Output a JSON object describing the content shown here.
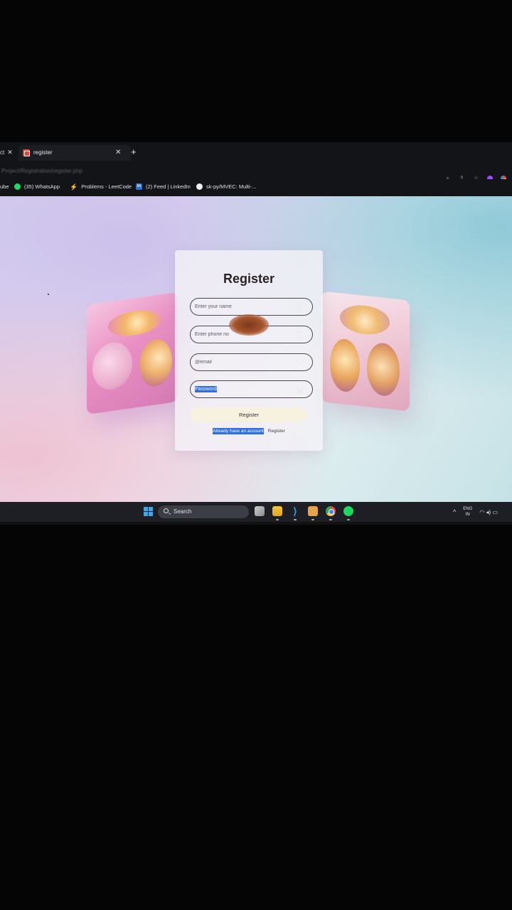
{
  "browser": {
    "prev_tab_label": "ct",
    "active_tab_title": "register",
    "url": "Project/Registration/register.php",
    "bookmarks": [
      {
        "label": "ube"
      },
      {
        "label": "(35) WhatsApp"
      },
      {
        "label": "Problems - LeetCode"
      },
      {
        "label": "(2) Feed | LinkedIn"
      },
      {
        "label": "sk-py/MVEC: Multi-..."
      }
    ]
  },
  "form": {
    "title": "Register",
    "name_placeholder": "Enter your name",
    "phone_placeholder": "Enter phone no",
    "email_placeholder": "@email",
    "password_placeholder": "Password",
    "submit_label": "Register",
    "footer_question": "Already have an account",
    "footer_link": "Register"
  },
  "taskbar": {
    "search_label": "Search",
    "lang_line1": "ENG",
    "lang_line2": "IN"
  }
}
